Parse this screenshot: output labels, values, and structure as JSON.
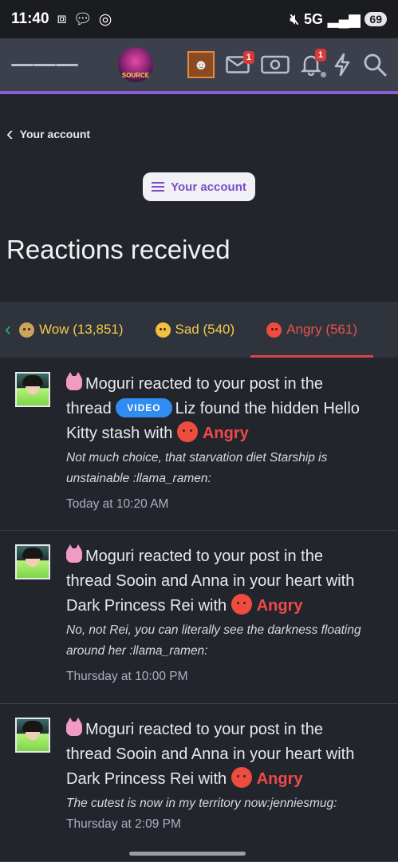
{
  "status_bar": {
    "time": "11:40",
    "network": "5G",
    "battery": "69"
  },
  "appbar": {
    "logo_text": "SOURCE",
    "mail_badge": "1",
    "alerts_badge": "1"
  },
  "breadcrumb": {
    "label": "Your account"
  },
  "account_button": {
    "label": "Your account"
  },
  "page_title": "Reactions received",
  "tabs": [
    {
      "label": "Wow (13,851)",
      "emoji": "wow-emoji",
      "active": false
    },
    {
      "label": "Sad (540)",
      "emoji": "sad-emoji",
      "active": false
    },
    {
      "label": "Angry (561)",
      "emoji": "angry-emoji",
      "active": true
    }
  ],
  "items": [
    {
      "line1": "Moguri reacted to your post in the",
      "line2_prefix": "thread",
      "video_badge": "VIDEO",
      "line2_suffix": "Liz found the hidden Hello",
      "line3": "Kitty stash with",
      "reaction": "Angry",
      "comment1": "Not much choice, that starvation diet Starship is",
      "comment2": "unstainable :llama_ramen:",
      "time": "Today at 10:20 AM"
    },
    {
      "line1": "Moguri reacted to your post in the",
      "line2": "thread Sooin and Anna in your heart with",
      "line3": "Dark Princess Rei with",
      "reaction": "Angry",
      "comment1": "No, not Rei, you can literally see the darkness floating",
      "comment2": "around her :llama_ramen:",
      "time": "Thursday at 10:00 PM"
    },
    {
      "line1": "Moguri reacted to your post in the",
      "line2": "thread Sooin and Anna in your heart with",
      "line3": "Dark Princess Rei with",
      "reaction": "Angry",
      "comment1": "The cutest is now in my territory now:jenniesmug:",
      "time": "Thursday at 2:09 PM"
    }
  ],
  "colors": {
    "accent": "#8e5bd6",
    "angry": "#f0494b",
    "wow": "#f3c94a",
    "link_green": "#29b36a"
  }
}
